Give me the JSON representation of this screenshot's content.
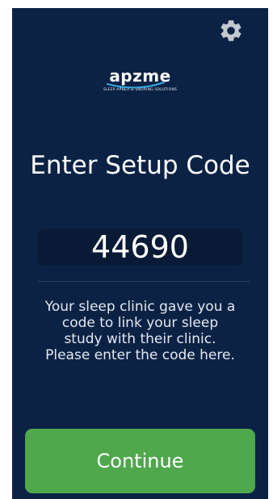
{
  "logo": {
    "wordmark": "apzme",
    "tagline": "SLEEP APNEA & SNORING SOLUTIONS"
  },
  "icons": {
    "settings": "gear-icon"
  },
  "setup": {
    "title": "Enter Setup Code",
    "code_value": "44690",
    "description": "Your sleep clinic gave you a code to link your sleep study with their clinic. Please enter the code here."
  },
  "actions": {
    "continue_label": "Continue"
  },
  "colors": {
    "background": "#0c2245",
    "accent_green": "#4fa84c",
    "logo_swoosh": "#36a9e1"
  }
}
